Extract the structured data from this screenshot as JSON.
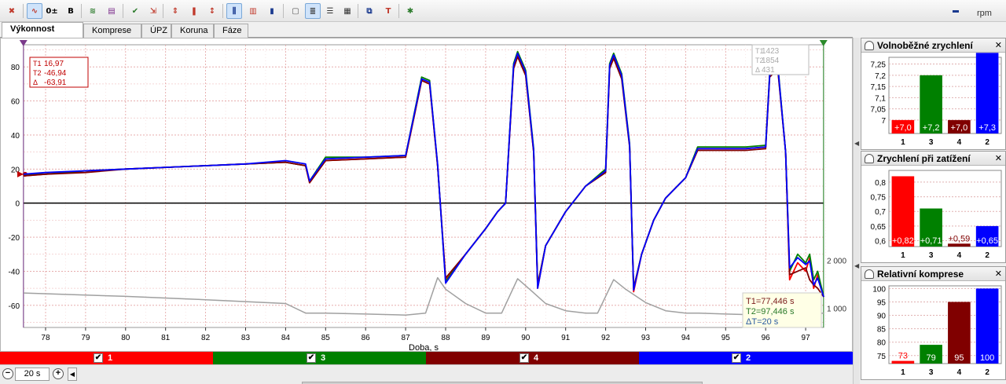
{
  "toolbar": {
    "buttons": [
      {
        "name": "delete-icon",
        "glyph": "✖",
        "color": "#c0392b",
        "active": false
      },
      {
        "name": "wave-icon",
        "glyph": "∿",
        "color": "#c0392b",
        "active": true
      },
      {
        "name": "zero-toggle-icon",
        "glyph": "0±",
        "color": "#000",
        "active": false
      },
      {
        "name": "bold-icon",
        "glyph": "B",
        "color": "#000",
        "active": false
      },
      {
        "name": "overlay-waves-icon",
        "glyph": "≋",
        "color": "#2a7a2a",
        "active": false
      },
      {
        "name": "colors-icon",
        "glyph": "▤",
        "color": "#7a2a8a",
        "active": false
      },
      {
        "name": "check-doc-icon",
        "glyph": "✔",
        "color": "#2a7a2a",
        "active": false
      },
      {
        "name": "export-doc-icon",
        "glyph": "⇲",
        "color": "#c0392b",
        "active": false
      },
      {
        "name": "vertical-arrows-icon",
        "glyph": "⇕",
        "color": "#c0392b",
        "active": false
      },
      {
        "name": "marker-icon",
        "glyph": "❚",
        "color": "#c0392b",
        "active": false
      },
      {
        "name": "scale-icon",
        "glyph": "↕",
        "color": "#c0392b",
        "active": false
      },
      {
        "name": "cursors-icon",
        "glyph": "⫼",
        "color": "#1a3a8f",
        "active": true
      },
      {
        "name": "bar-cursor-icon",
        "glyph": "▥",
        "color": "#c0392b",
        "active": false
      },
      {
        "name": "bar-chart-icon",
        "glyph": "▮",
        "color": "#1a3a8f",
        "active": false
      },
      {
        "name": "page-icon",
        "glyph": "▢",
        "color": "#555",
        "active": false
      },
      {
        "name": "list-view-icon",
        "glyph": "≣",
        "color": "#333",
        "active": true
      },
      {
        "name": "grid-view-icon",
        "glyph": "☰",
        "color": "#333",
        "active": false
      },
      {
        "name": "columns-view-icon",
        "glyph": "▦",
        "color": "#333",
        "active": false
      },
      {
        "name": "copy-icon",
        "glyph": "⧉",
        "color": "#1a3a8f",
        "active": false
      },
      {
        "name": "text-settings-icon",
        "glyph": "T",
        "color": "#c0392b",
        "active": false
      },
      {
        "name": "bug-icon",
        "glyph": "✱",
        "color": "#2a7a2a",
        "active": false
      }
    ],
    "rpm_label": "rpm"
  },
  "tabs": [
    "Výkonnost válců",
    "Komprese",
    "ÚPZ",
    "Koruna",
    "Fáze"
  ],
  "active_tab": 0,
  "colors": {
    "c1": "#ff0000",
    "c3": "#008000",
    "c4": "#800000",
    "c2": "#0000ff",
    "rpm": "#a0a0a0"
  },
  "cursor_box_left": {
    "t1_label": "T1",
    "t1_value": "16,97",
    "t2_label": "T2",
    "t2_value": "-46,94",
    "delta_label": "Δ",
    "delta_value": "-63,91"
  },
  "cursor_box_right": {
    "t1_label": "T1",
    "t1_value": "1423",
    "t2_label": "T2",
    "t2_value": "1854",
    "delta_label": "Δ",
    "delta_value": "431"
  },
  "time_box": {
    "t1": "T1=77,446 s",
    "t2": "T2=97,446 s",
    "dt": "ΔT=20 s"
  },
  "main_chart": {
    "x_label": "Doba, s",
    "x_ticks": [
      "78",
      "79",
      "80",
      "81",
      "82",
      "83",
      "84",
      "85",
      "86",
      "87",
      "88",
      "89",
      "90",
      "91",
      "92",
      "93",
      "94",
      "95",
      "96",
      "97"
    ],
    "y_ticks": [
      "80",
      "60",
      "40",
      "20",
      "0",
      "-20",
      "-40",
      "-60"
    ],
    "y2_ticks": [
      "2 000",
      "1 000"
    ]
  },
  "chart_data": [
    {
      "type": "line",
      "title": "",
      "xlabel": "Doba, s",
      "ylabel": "",
      "xlim": [
        77.45,
        97.45
      ],
      "ylim": [
        -73,
        93
      ],
      "secondary_axis": {
        "ticks": [
          2000,
          1000
        ]
      },
      "grid": true,
      "series": [
        {
          "name": "1",
          "color": "#ff0000",
          "x": [
            77.45,
            78,
            79,
            80,
            81,
            82,
            83,
            84,
            84.5,
            84.6,
            85,
            86,
            87,
            87.4,
            87.6,
            87.8,
            88,
            88.5,
            89,
            89.3,
            89.5,
            89.7,
            89.8,
            90,
            90.2,
            90.3,
            90.5,
            91,
            91.5,
            92,
            92.1,
            92.2,
            92.4,
            92.6,
            92.7,
            92.9,
            93.2,
            93.5,
            94,
            94.3,
            95,
            95.5,
            96,
            96.1,
            96.3,
            96.5,
            96.6,
            96.8,
            97,
            97.1,
            97.2,
            97.3,
            97.45
          ],
          "y": [
            16,
            17,
            19,
            20,
            21,
            22,
            23,
            24,
            22,
            12,
            25,
            26,
            27,
            72,
            70,
            22,
            -45,
            -30,
            -15,
            -5,
            0,
            80,
            87,
            76,
            30,
            -50,
            -25,
            -5,
            10,
            19,
            80,
            86,
            74,
            34,
            -52,
            -30,
            -10,
            3,
            15,
            32,
            32,
            32,
            33,
            75,
            80,
            30,
            -45,
            -35,
            -40,
            -32,
            -50,
            -42,
            -55
          ]
        },
        {
          "name": "3",
          "color": "#008000",
          "x": [
            77.45,
            78,
            79,
            80,
            81,
            82,
            83,
            84,
            84.5,
            84.6,
            85,
            86,
            87,
            87.4,
            87.6,
            87.8,
            88,
            88.5,
            89,
            89.3,
            89.5,
            89.7,
            89.8,
            90,
            90.2,
            90.3,
            90.5,
            91,
            91.5,
            92,
            92.1,
            92.2,
            92.4,
            92.6,
            92.7,
            92.9,
            93.2,
            93.5,
            94,
            94.3,
            95,
            95.5,
            96,
            96.1,
            96.3,
            96.5,
            96.6,
            96.8,
            97,
            97.1,
            97.2,
            97.3,
            97.45
          ],
          "y": [
            17,
            17,
            19,
            20,
            21,
            22,
            23,
            24,
            22,
            13,
            27,
            27,
            28,
            74,
            72,
            22,
            -46,
            -30,
            -15,
            -5,
            0,
            82,
            89,
            78,
            32,
            -48,
            -25,
            -5,
            10,
            20,
            82,
            88,
            76,
            35,
            -50,
            -30,
            -10,
            3,
            15,
            33,
            33,
            33,
            34,
            76,
            82,
            30,
            -40,
            -30,
            -35,
            -30,
            -45,
            -40,
            -55
          ]
        },
        {
          "name": "4",
          "color": "#800000",
          "x": [
            77.45,
            78,
            79,
            80,
            81,
            82,
            83,
            84,
            84.5,
            84.6,
            85,
            86,
            87,
            87.4,
            87.6,
            87.8,
            88,
            88.5,
            89,
            89.3,
            89.5,
            89.7,
            89.8,
            90,
            90.2,
            90.3,
            90.5,
            91,
            91.5,
            92,
            92.1,
            92.2,
            92.4,
            92.6,
            92.7,
            92.9,
            93.2,
            93.5,
            94,
            94.3,
            95,
            95.5,
            96,
            96.1,
            96.3,
            96.5,
            96.6,
            96.8,
            97,
            97.1,
            97.2,
            97.3,
            97.45
          ],
          "y": [
            16,
            17,
            18,
            20,
            21,
            22,
            23,
            24,
            22,
            12,
            25,
            26,
            27,
            72,
            70,
            22,
            -44,
            -30,
            -15,
            -5,
            0,
            79,
            86,
            75,
            30,
            -48,
            -25,
            -5,
            10,
            18,
            79,
            85,
            73,
            33,
            -50,
            -30,
            -10,
            3,
            15,
            31,
            31,
            31,
            32,
            74,
            79,
            30,
            -42,
            -40,
            -38,
            -45,
            -48,
            -50,
            -55
          ]
        },
        {
          "name": "2",
          "color": "#0000ff",
          "x": [
            77.45,
            78,
            79,
            80,
            81,
            82,
            83,
            84,
            84.5,
            84.6,
            85,
            86,
            87,
            87.4,
            87.6,
            87.8,
            88,
            88.5,
            89,
            89.3,
            89.5,
            89.7,
            89.8,
            90,
            90.2,
            90.3,
            90.5,
            91,
            91.5,
            92,
            92.1,
            92.2,
            92.4,
            92.6,
            92.7,
            92.9,
            93.2,
            93.5,
            94,
            94.3,
            95,
            95.5,
            96,
            96.1,
            96.3,
            96.5,
            96.6,
            96.8,
            97,
            97.1,
            97.2,
            97.3,
            97.45
          ],
          "y": [
            17,
            18,
            19,
            20,
            21,
            22,
            23,
            25,
            23,
            13,
            26,
            27,
            28,
            73,
            71,
            23,
            -47,
            -30,
            -15,
            -5,
            0,
            81,
            88,
            77,
            31,
            -50,
            -25,
            -5,
            10,
            19,
            81,
            87,
            75,
            34,
            -51,
            -30,
            -10,
            3,
            15,
            32,
            32,
            32,
            33,
            75,
            81,
            30,
            -38,
            -32,
            -36,
            -34,
            -48,
            -44,
            -55
          ]
        },
        {
          "name": "rpm",
          "color": "#a0a0a0",
          "x": [
            77.45,
            80,
            82,
            84,
            84.5,
            85,
            86,
            87,
            87.5,
            87.8,
            88,
            88.5,
            89,
            89.4,
            89.8,
            90.1,
            90.5,
            91,
            91.5,
            91.8,
            92.2,
            92.5,
            93,
            93.5,
            94,
            94.3,
            95,
            96,
            96.5,
            97,
            97.45
          ],
          "y": [
            1320,
            1250,
            1180,
            1100,
            900,
            900,
            880,
            860,
            900,
            1640,
            1400,
            1100,
            900,
            900,
            1620,
            1400,
            1100,
            950,
            900,
            900,
            1600,
            1400,
            1120,
            950,
            900,
            900,
            880,
            860,
            860,
            880,
            900
          ]
        }
      ]
    },
    {
      "type": "bar",
      "title": "Volnoběžné zrychlení",
      "categories": [
        "1",
        "3",
        "4",
        "2"
      ],
      "values": [
        7.0,
        7.2,
        7.0,
        7.3
      ],
      "data_labels": [
        "+7,0",
        "+7,2",
        "+7,0",
        "+7,3"
      ],
      "colors": [
        "#ff0000",
        "#008000",
        "#800000",
        "#0000ff"
      ],
      "ylim": [
        6.94,
        7.28
      ],
      "y_ticks": [
        "7,25",
        "7,2",
        "7,15",
        "7,1",
        "7,05",
        "7"
      ]
    },
    {
      "type": "bar",
      "title": "Zrychlení při zatížení",
      "categories": [
        "1",
        "3",
        "4",
        "2"
      ],
      "values": [
        0.82,
        0.71,
        0.59,
        0.65
      ],
      "data_labels": [
        "+0,82",
        "+0,71",
        "+0,59",
        "+0,65"
      ],
      "colors": [
        "#ff0000",
        "#008000",
        "#800000",
        "#0000ff"
      ],
      "ylim": [
        0.58,
        0.84
      ],
      "y_ticks": [
        "0,8",
        "0,75",
        "0,7",
        "0,65",
        "0,6"
      ]
    },
    {
      "type": "bar",
      "title": "Relativní komprese",
      "categories": [
        "1",
        "3",
        "4",
        "2"
      ],
      "values": [
        73,
        79,
        95,
        100
      ],
      "data_labels": [
        "73",
        "79",
        "95",
        "100"
      ],
      "colors": [
        "#ff0000",
        "#008000",
        "#800000",
        "#0000ff"
      ],
      "ylim": [
        72,
        101
      ],
      "y_ticks": [
        "100",
        "95",
        "90",
        "85",
        "80",
        "75"
      ]
    }
  ],
  "legend": [
    {
      "label": "1",
      "color": "#ff0000",
      "checked": "✔"
    },
    {
      "label": "3",
      "color": "#008000",
      "checked": "✔"
    },
    {
      "label": "4",
      "color": "#800000",
      "checked": "✔"
    },
    {
      "label": "2",
      "color": "#0000ff",
      "checked": "✔"
    }
  ],
  "bottom": {
    "zoom_minus": "−",
    "zoom_value": "20 s",
    "zoom_plus": "+",
    "scroll_left": "◀"
  },
  "panel_close": "✕"
}
